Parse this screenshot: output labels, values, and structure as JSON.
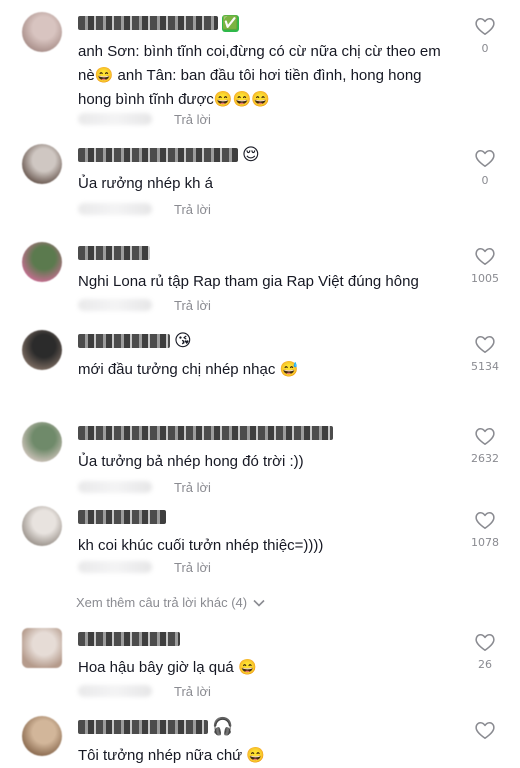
{
  "reply_label": "Trả lời",
  "view_more": "Xem thêm câu trả lời khác (4)",
  "comments": [
    {
      "name_badge": "✅",
      "text": "anh Sơn: bình tĩnh coi,đừng có cừ nữa chị cừ theo em nè😄 anh Tân: ban đầu tôi hơi tiền đình, hong hong hong bình tĩnh được😄😄😄",
      "likes": "0",
      "avatar_colors": [
        "#d8c4c0",
        "#a98f8a"
      ]
    },
    {
      "name_badge": "😌",
      "text": "Ủa rưởng nhép kh á",
      "likes": "0",
      "avatar_colors": [
        "#cfc7c2",
        "#6b5a52"
      ]
    },
    {
      "name_badge": "",
      "text": "Nghi Lona rủ tập Rap tham gia Rap Việt đúng hông",
      "likes": "1005",
      "avatar_colors": [
        "#5b7a4e",
        "#c46d8f"
      ]
    },
    {
      "name_badge": "😘",
      "text": "mới đầu tưởng chị nhép nhạc 😅",
      "likes": "5134",
      "avatar_colors": [
        "#2b2b2b",
        "#7a6a60"
      ]
    },
    {
      "name_badge": "",
      "text": "Ủa tưởng bả nhép hong đó trời :))",
      "likes": "2632",
      "avatar_colors": [
        "#6f8a6a",
        "#c9c0b6"
      ]
    },
    {
      "name_badge": "",
      "text": "kh coi khúc cuối tưởn nhép thiệc=))))",
      "likes": "1078",
      "avatar_colors": [
        "#e8e3df",
        "#9c948d"
      ]
    },
    {
      "name_badge": "",
      "text": "Hoa hậu bây giờ lạ quá 😄",
      "likes": "26",
      "avatar_colors": [
        "#e6dcd6",
        "#b59b8c"
      ]
    },
    {
      "name_badge": "🎧",
      "text": "Tôi tưởng nhép nữa chứ 😄",
      "likes": "",
      "avatar_colors": [
        "#d2b69a",
        "#8a6a4f"
      ]
    }
  ]
}
